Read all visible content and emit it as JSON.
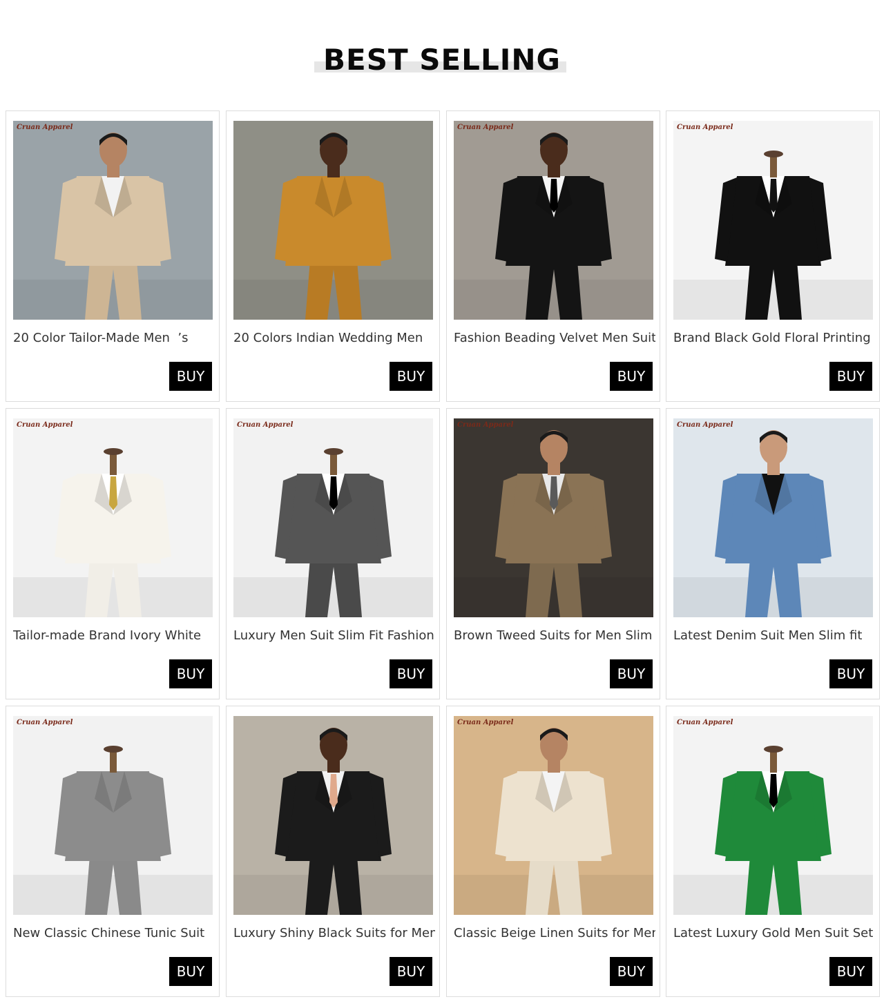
{
  "section": {
    "heading": "BEST SELLING"
  },
  "products": [
    {
      "title": "20 Color Tailor-Made Men  ’s",
      "buy_label": "BUY",
      "brand": "Cruan Apparel",
      "bg": "#9aa3a8",
      "suit": "#d9c4a6",
      "shirt": "#f2f2f2",
      "tie": "",
      "pants": "#cdb594",
      "skin": "#b58463"
    },
    {
      "title": "20 Colors Indian Wedding Men",
      "buy_label": "BUY",
      "brand": "",
      "bg": "#8f8f86",
      "suit": "#c98a2c",
      "shirt": "#c98a2c",
      "tie": "",
      "pants": "#b87b24",
      "skin": "#4a2c1c"
    },
    {
      "title": "Fashion Beading Velvet Men Suit",
      "buy_label": "BUY",
      "brand": "Cruan Apparel",
      "bg": "#a19b93",
      "suit": "#141414",
      "shirt": "#f5f5f5",
      "tie": "#000000",
      "pants": "#141414",
      "skin": "#4a2c1c"
    },
    {
      "title": "Brand Black Gold Floral Printing",
      "buy_label": "BUY",
      "brand": "Cruan Apparel",
      "bg": "#f4f4f4",
      "suit": "#111111",
      "shirt": "#ffffff",
      "tie": "#111111",
      "pants": "#111111",
      "skin": ""
    },
    {
      "title": "Tailor-made Brand Ivory White",
      "buy_label": "BUY",
      "brand": "Cruan Apparel",
      "bg": "#f3f3f3",
      "suit": "#f6f3ec",
      "shirt": "#ffffff",
      "tie": "#c8a640",
      "pants": "#f1eee7",
      "skin": ""
    },
    {
      "title": "Luxury Men Suit Slim Fit Fashion",
      "buy_label": "BUY",
      "brand": "Cruan Apparel",
      "bg": "#f2f2f2",
      "suit": "#555555",
      "shirt": "#ffffff",
      "tie": "#000000",
      "pants": "#4a4a4a",
      "skin": ""
    },
    {
      "title": "Brown Tweed Suits for Men Slim",
      "buy_label": "BUY",
      "brand": "Cruan Apparel",
      "bg": "#3b3631",
      "suit": "#8a7355",
      "shirt": "#e8e8e8",
      "tie": "#5a5a5a",
      "pants": "#7e6a4f",
      "skin": "#b58463"
    },
    {
      "title": "Latest Denim Suit Men Slim fit",
      "buy_label": "BUY",
      "brand": "Cruan Apparel",
      "bg": "#dfe6ec",
      "suit": "#5d87b8",
      "shirt": "#111111",
      "tie": "",
      "pants": "#5d87b8",
      "skin": "#c99a7a"
    },
    {
      "title": "New Classic Chinese Tunic Suit",
      "buy_label": "BUY",
      "brand": "Cruan Apparel",
      "bg": "#f2f2f2",
      "suit": "#8c8c8c",
      "shirt": "#8c8c8c",
      "tie": "",
      "pants": "#8a8a8a",
      "skin": ""
    },
    {
      "title": "Luxury Shiny Black Suits for Men",
      "buy_label": "BUY",
      "brand": "",
      "bg": "#b9b2a6",
      "suit": "#1b1b1b",
      "shirt": "#f2f2f2",
      "tie": "#e0a98c",
      "pants": "#1b1b1b",
      "skin": "#4a2c1c"
    },
    {
      "title": "Classic Beige Linen Suits for Men",
      "buy_label": "BUY",
      "brand": "Cruan Apparel",
      "bg": "#d7b58a",
      "suit": "#ede2cf",
      "shirt": "#f4f4f4",
      "tie": "",
      "pants": "#e6dcc9",
      "skin": "#b58463"
    },
    {
      "title": "Latest Luxury Gold Men Suit Set",
      "buy_label": "BUY",
      "brand": "Cruan Apparel",
      "bg": "#f3f3f3",
      "suit": "#1f8a3a",
      "shirt": "#ffffff",
      "tie": "#000000",
      "pants": "#1f8a3a",
      "skin": ""
    }
  ]
}
